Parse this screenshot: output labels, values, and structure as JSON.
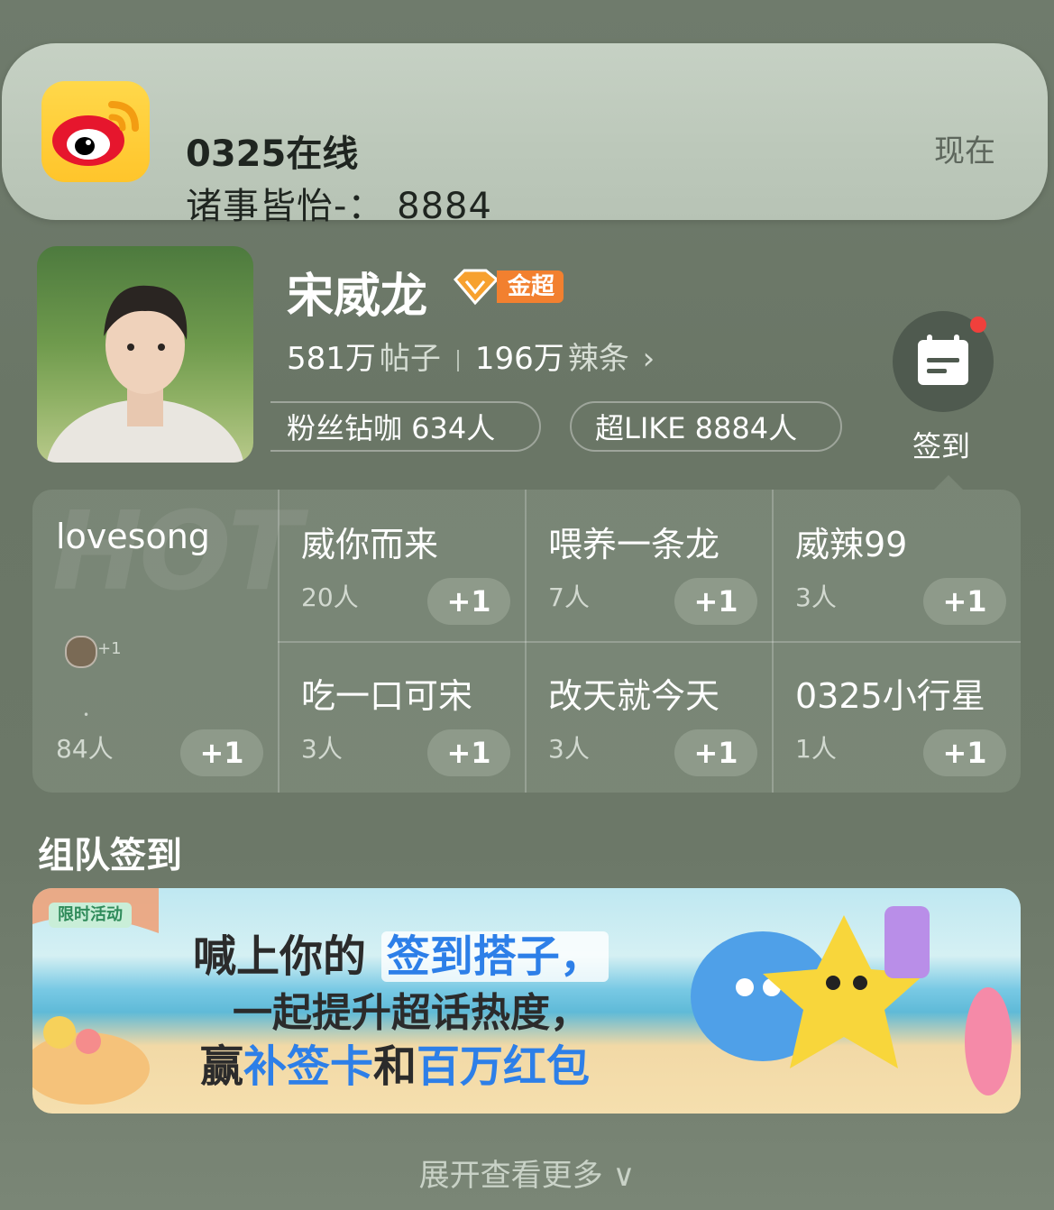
{
  "notification": {
    "title": "0325在线",
    "body": "诸事皆怡-：  8884",
    "time": "现在"
  },
  "profile": {
    "name": "宋威龙",
    "badge_label": "金超",
    "posts_value": "581万",
    "posts_label": "帖子",
    "spicy_value": "196万",
    "spicy_label": "辣条",
    "fans_pill": "粉丝钻咖 634人",
    "like_pill": "超LIKE 8884人",
    "checkin_label": "签到"
  },
  "grid": {
    "hot_watermark": "HOT",
    "featured": {
      "title": "lovesong",
      "count": "84人",
      "plus": "+1",
      "mini_plus": "+1"
    },
    "cells": [
      {
        "title": "威你而来",
        "count": "20人",
        "plus": "+1"
      },
      {
        "title": "喂养一条龙",
        "count": "7人",
        "plus": "+1"
      },
      {
        "title": "威辣99",
        "count": "3人",
        "plus": "+1"
      },
      {
        "title": "吃一口可宋",
        "count": "3人",
        "plus": "+1"
      },
      {
        "title": "改天就今天",
        "count": "3人",
        "plus": "+1"
      },
      {
        "title": "0325小行星",
        "count": "1人",
        "plus": "+1"
      }
    ]
  },
  "team": {
    "title": "组队签到",
    "banner": {
      "tag": "限时活动",
      "line1_a": "喊上你的",
      "line1_b": "签到搭子，",
      "line2": "一起提升超话热度，",
      "line3_a": "赢",
      "line3_b": "补签卡",
      "line3_c": "和",
      "line3_d": "百万红包"
    }
  },
  "expand_label": "展开查看更多 ∨",
  "colors": {
    "accent_orange": "#f2802f",
    "accent_blue": "#2d7fe8",
    "notif_dot": "#f0403c"
  }
}
